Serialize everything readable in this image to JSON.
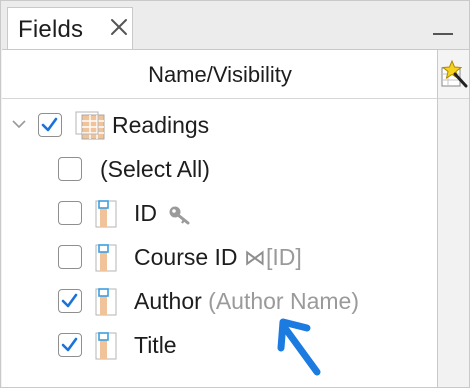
{
  "panel": {
    "tab_label": "Fields",
    "column_header": "Name/Visibility"
  },
  "tree": {
    "table": {
      "label": "Readings",
      "checked": true,
      "expanded": true
    },
    "select_all": {
      "label": "(Select All)",
      "checked": false
    },
    "fields": [
      {
        "label": "ID",
        "checked": false,
        "badge": "key-icon"
      },
      {
        "label": "Course ID",
        "checked": false,
        "link_glyph": "⋈",
        "link_target": "[ID]"
      },
      {
        "label": "Author",
        "checked": true,
        "alias": "(Author Name)"
      },
      {
        "label": "Title",
        "checked": true
      }
    ]
  },
  "colors": {
    "accent": "#1a73d9",
    "checkbox_border": "#8f8f8f",
    "alias_text": "#9a9a9a",
    "field_icon_fill": "#f0c39a",
    "field_icon_key": "#3ba0e0",
    "arrow": "#1c7be0"
  }
}
